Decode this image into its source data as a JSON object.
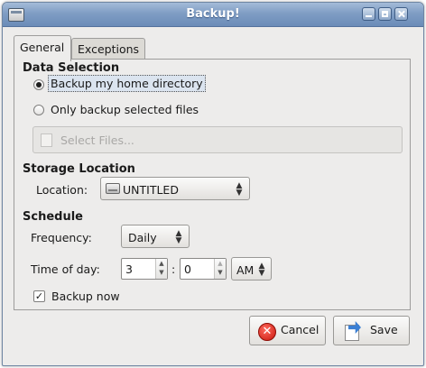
{
  "window": {
    "title": "Backup!"
  },
  "tabs": [
    {
      "label": "General",
      "active": true
    },
    {
      "label": "Exceptions",
      "active": false
    }
  ],
  "data_selection": {
    "heading": "Data Selection",
    "option_home": "Backup my home directory",
    "option_selected": "Only backup selected files",
    "selected_option": "home",
    "select_files_button": "Select Files..."
  },
  "storage": {
    "heading": "Storage Location",
    "location_label": "Location:",
    "location_value": "UNTITLED",
    "location_icon": "drive-icon"
  },
  "schedule": {
    "heading": "Schedule",
    "frequency_label": "Frequency:",
    "frequency_value": "Daily",
    "time_label": "Time of day:",
    "hour_value": "3",
    "separator": ":",
    "minute_value": "0",
    "ampm_value": "AM",
    "backup_now_label": "Backup now",
    "backup_now_checked": true
  },
  "buttons": {
    "cancel_label": "Cancel",
    "save_label": "Save"
  }
}
